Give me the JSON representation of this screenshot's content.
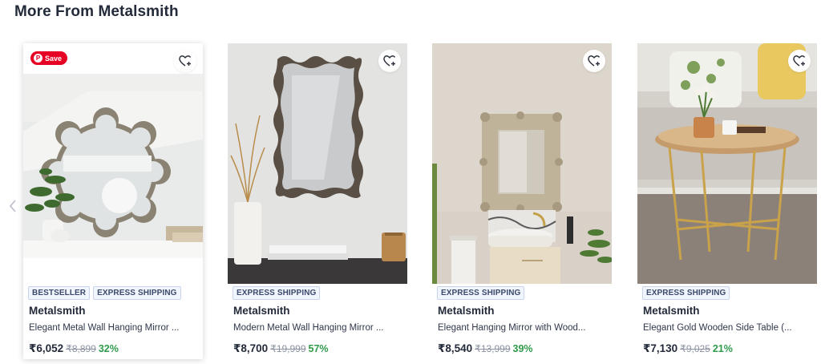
{
  "section": {
    "title": "More From Metalsmith"
  },
  "carousel": {
    "prev_icon": "chevron-left-icon"
  },
  "products": [
    {
      "tags": [
        "BESTSELLER",
        "EXPRESS SHIPPING"
      ],
      "brand": "Metalsmith",
      "name": "Elegant Metal Wall Hanging Mirror ...",
      "price": "₹6,052",
      "mrp": "₹8,899",
      "discount": "32%",
      "save_label": "Save"
    },
    {
      "tags": [
        "EXPRESS SHIPPING"
      ],
      "brand": "Metalsmith",
      "name": "Modern Metal Wall Hanging Mirror ...",
      "price": "₹8,700",
      "mrp": "₹19,999",
      "discount": "57%"
    },
    {
      "tags": [
        "EXPRESS SHIPPING"
      ],
      "brand": "Metalsmith",
      "name": "Elegant Hanging Mirror with Wood...",
      "price": "₹8,540",
      "mrp": "₹13,999",
      "discount": "39%"
    },
    {
      "tags": [
        "EXPRESS SHIPPING"
      ],
      "brand": "Metalsmith",
      "name": "Elegant Gold Wooden Side Table (...",
      "price": "₹7,130",
      "mrp": "₹9,025",
      "discount": "21%"
    }
  ],
  "colors": {
    "discount": "#2f9a4a",
    "pinterest": "#e60023",
    "tag_bg": "#f1f5fd"
  }
}
